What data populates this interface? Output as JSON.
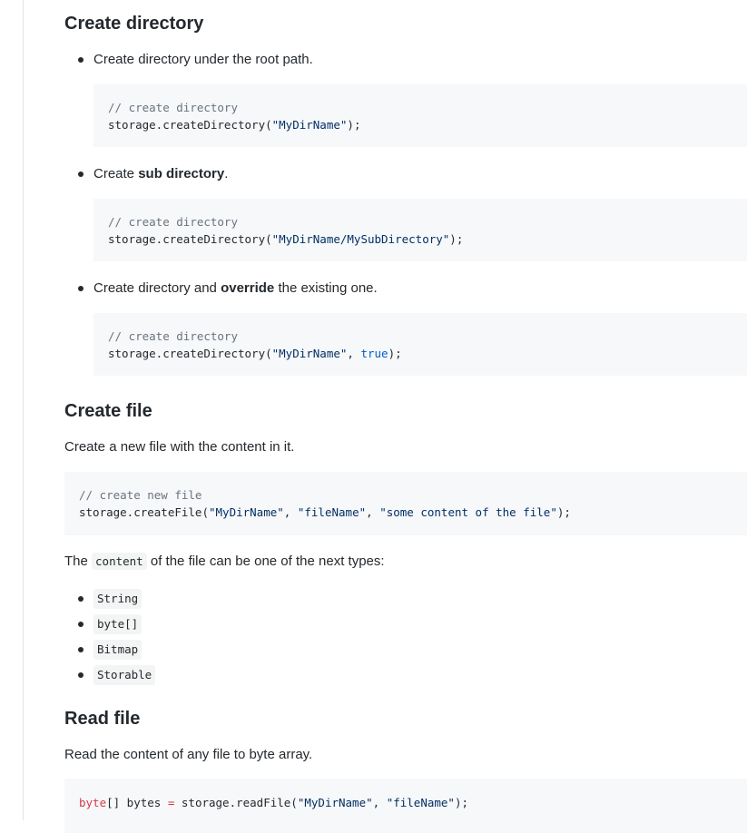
{
  "sections": {
    "create_directory": {
      "title": "Create directory",
      "items": [
        {
          "text_parts": [
            "Create directory under the root path."
          ],
          "code": {
            "comment": "// create directory",
            "call": "storage.createDirectory(",
            "arg1": "\"MyDirName\"",
            "close": ");"
          }
        },
        {
          "text_before": "Create ",
          "text_bold": "sub directory",
          "text_after": ".",
          "code": {
            "comment": "// create directory",
            "call": "storage.createDirectory(",
            "arg1": "\"MyDirName/MySubDirectory\"",
            "close": ");"
          }
        },
        {
          "text_before": "Create directory and ",
          "text_bold": "override",
          "text_after": " the existing one.",
          "code": {
            "comment": "// create directory",
            "call": "storage.createDirectory(",
            "arg1": "\"MyDirName\"",
            "sep": ", ",
            "arg2": "true",
            "close": ");"
          }
        }
      ]
    },
    "create_file": {
      "title": "Create file",
      "description": "Create a new file with the content in it.",
      "code": {
        "comment": "// create new file",
        "call": "storage.createFile(",
        "arg1": "\"MyDirName\"",
        "sep1": ", ",
        "arg2": "\"fileName\"",
        "sep2": ", ",
        "arg3": "\"some content of the file\"",
        "close": ");"
      },
      "types_intro_before": "The ",
      "types_intro_code": "content",
      "types_intro_after": " of the file can be one of the next types:",
      "types": [
        "String",
        "byte[]",
        "Bitmap",
        "Storable"
      ]
    },
    "read_file": {
      "title": "Read file",
      "description": "Read the content of any file to byte array.",
      "code": {
        "type": "byte",
        "brackets": "[] bytes ",
        "eq": "=",
        "call": " storage.readFile(",
        "arg1": "\"MyDirName\"",
        "sep": ", ",
        "arg2": "\"fileName\"",
        "close": ");"
      }
    }
  }
}
